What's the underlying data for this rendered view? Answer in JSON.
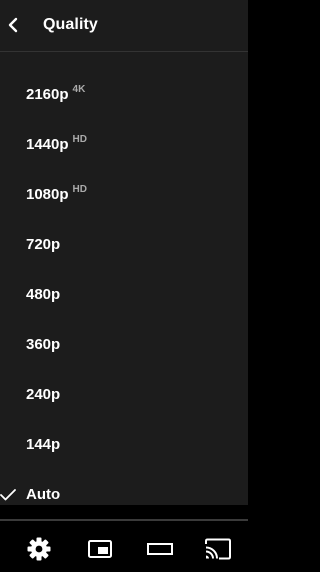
{
  "header": {
    "title": "Quality"
  },
  "quality_options": [
    {
      "label": "2160p",
      "badge": "4K"
    },
    {
      "label": "1440p",
      "badge": "HD"
    },
    {
      "label": "1080p",
      "badge": "HD"
    },
    {
      "label": "720p"
    },
    {
      "label": "480p"
    },
    {
      "label": "360p"
    },
    {
      "label": "240p"
    },
    {
      "label": "144p"
    },
    {
      "label": "Auto",
      "selected": true
    }
  ],
  "controls": {
    "icons": [
      "gear-icon",
      "miniplayer-icon",
      "theater-mode-icon",
      "cast-icon"
    ]
  },
  "colors": {
    "panel_background": "#1c1c1c",
    "text": "#ffffff",
    "badge_text": "#aaaaaa",
    "controls_background": "#000000"
  }
}
